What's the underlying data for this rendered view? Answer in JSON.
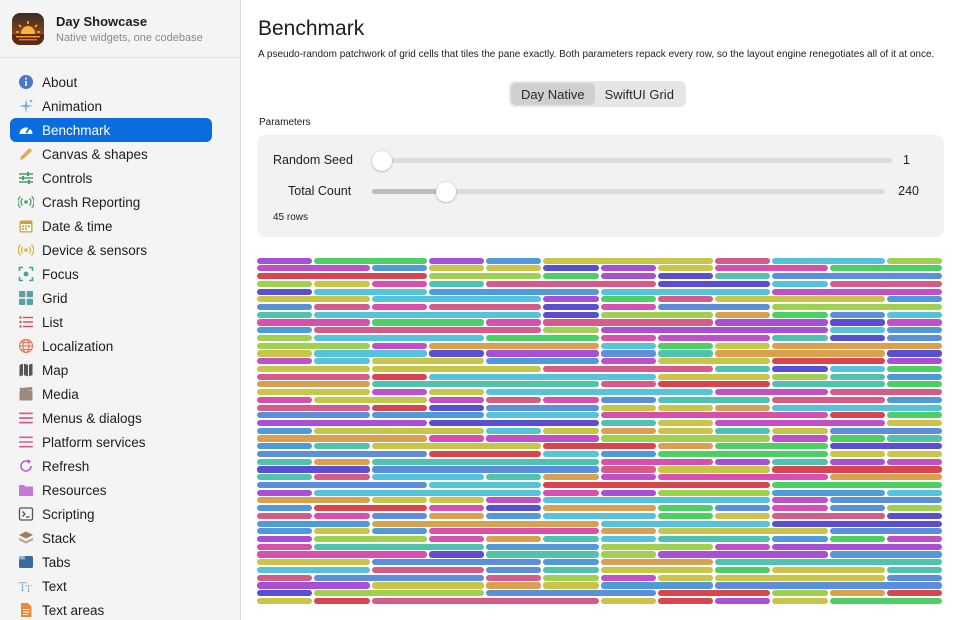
{
  "app": {
    "name": "Day Showcase",
    "subtitle": "Native widgets, one codebase"
  },
  "sidebar": {
    "items": [
      {
        "label": "About",
        "icon": "info-icon",
        "color": "#4a78c8",
        "active": false
      },
      {
        "label": "Animation",
        "icon": "sparkles-icon",
        "color": "#7fb4e8",
        "active": false
      },
      {
        "label": "Benchmark",
        "icon": "gauge-icon",
        "color": "#ffffff",
        "active": true
      },
      {
        "label": "Canvas & shapes",
        "icon": "pencil-icon",
        "color": "#e8a94a",
        "active": false
      },
      {
        "label": "Controls",
        "icon": "sliders-icon",
        "color": "#4aa06a",
        "active": false
      },
      {
        "label": "Crash Reporting",
        "icon": "broadcast-icon",
        "color": "#4aa06a",
        "active": false
      },
      {
        "label": "Date & time",
        "icon": "calendar-icon",
        "color": "#c9a23a",
        "active": false
      },
      {
        "label": "Device & sensors",
        "icon": "sensor-icon",
        "color": "#d9b43a",
        "active": false
      },
      {
        "label": "Focus",
        "icon": "focus-icon",
        "color": "#4aa0a0",
        "active": false
      },
      {
        "label": "Grid",
        "icon": "grid-icon",
        "color": "#5aa0a0",
        "active": false
      },
      {
        "label": "List",
        "icon": "list-icon",
        "color": "#d94a5a",
        "active": false
      },
      {
        "label": "Localization",
        "icon": "globe-icon",
        "color": "#e87a5a",
        "active": false
      },
      {
        "label": "Map",
        "icon": "map-icon",
        "color": "#555555",
        "active": false
      },
      {
        "label": "Media",
        "icon": "film-icon",
        "color": "#9a8a80",
        "active": false
      },
      {
        "label": "Menus & dialogs",
        "icon": "menu-icon",
        "color": "#d95a8a",
        "active": false
      },
      {
        "label": "Platform services",
        "icon": "lines-icon",
        "color": "#d95a8a",
        "active": false
      },
      {
        "label": "Refresh",
        "icon": "refresh-icon",
        "color": "#b05ad0",
        "active": false
      },
      {
        "label": "Resources",
        "icon": "folder-icon",
        "color": "#c47ad0",
        "active": false
      },
      {
        "label": "Scripting",
        "icon": "terminal-icon",
        "color": "#555555",
        "active": false
      },
      {
        "label": "Stack",
        "icon": "stack-icon",
        "color": "#a07a5a",
        "active": false
      },
      {
        "label": "Tabs",
        "icon": "tabs-icon",
        "color": "#3a6aa0",
        "active": false
      },
      {
        "label": "Text",
        "icon": "text-icon",
        "color": "#8ab0d0",
        "active": false
      },
      {
        "label": "Text areas",
        "icon": "document-icon",
        "color": "#e88a3a",
        "active": false
      }
    ]
  },
  "main": {
    "title": "Benchmark",
    "description": "A pseudo-random patchwork of grid cells that tiles the pane exactly. Both parameters repack every row, so the layout engine renegotiates all of it at once.",
    "segments": [
      {
        "label": "Day Native",
        "selected": true
      },
      {
        "label": "SwiftUI Grid",
        "selected": false
      }
    ],
    "params_label": "Parameters",
    "params": [
      {
        "label": "Random Seed",
        "value": "1",
        "fraction": 0.0
      },
      {
        "label": "Total Count",
        "value": "240",
        "fraction": 0.13
      }
    ],
    "rows_note": "45 rows",
    "grid_rows": 45,
    "grid_cols": 12,
    "palette": [
      "#d9454f",
      "#4cd063",
      "#a84fd6",
      "#c8c548",
      "#c8c548",
      "#55c3d9",
      "#d94fb0",
      "#5b8fd9",
      "#d9a04f",
      "#4fc2b0",
      "#d65a8a",
      "#5a4fd0",
      "#9fd04f",
      "#c04fc8",
      "#4f9ad9"
    ]
  }
}
